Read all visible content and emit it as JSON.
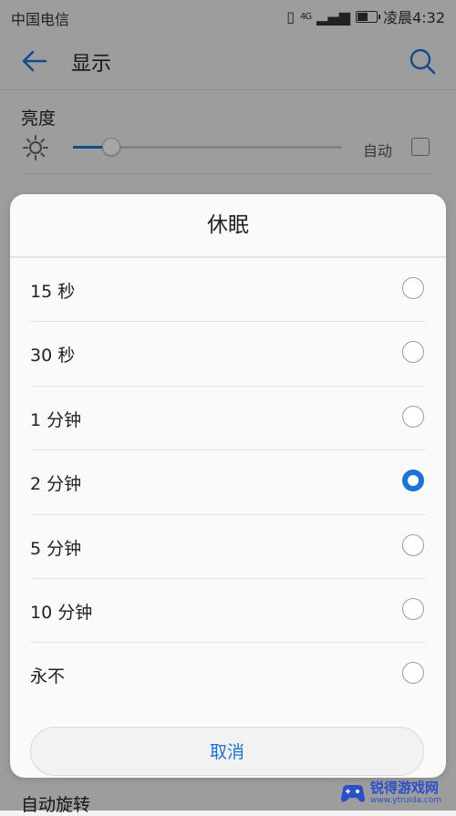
{
  "status_bar": {
    "carrier": "中国电信",
    "network": "4G",
    "time": "凌晨4:32",
    "battery_level": 0.6
  },
  "app_bar": {
    "title": "显示"
  },
  "brightness": {
    "label": "亮度",
    "level": 0.14,
    "auto_label": "自动",
    "auto_checked": false
  },
  "background_rows": {
    "bottom_label": "自动旋转"
  },
  "dialog": {
    "title": "休眠",
    "options": [
      {
        "label": "15 秒",
        "selected": false
      },
      {
        "label": "30 秒",
        "selected": false
      },
      {
        "label": "1 分钟",
        "selected": false
      },
      {
        "label": "2 分钟",
        "selected": true
      },
      {
        "label": "5 分钟",
        "selected": false
      },
      {
        "label": "10 分钟",
        "selected": false
      },
      {
        "label": "永不",
        "selected": false
      }
    ],
    "cancel_label": "取消"
  },
  "watermark": {
    "name": "锐得游戏网",
    "url": "www.ytruida.com"
  },
  "colors": {
    "accent": "#1a73d9",
    "watermark": "#2b4fc9"
  },
  "icons": {
    "back": "arrow-left-icon",
    "search": "search-icon",
    "brightness": "sun-icon"
  }
}
